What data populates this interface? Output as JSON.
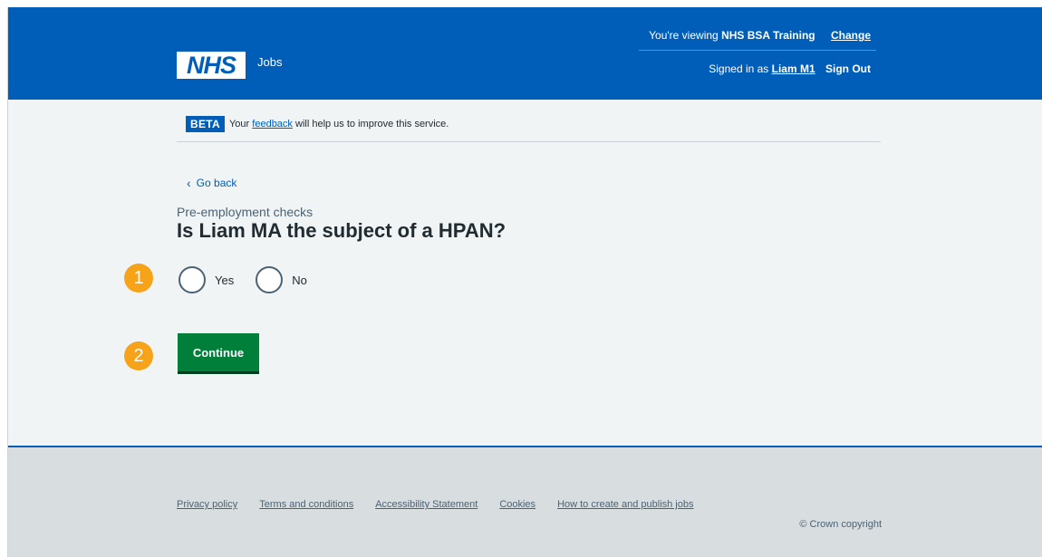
{
  "header": {
    "logo_text": "NHS",
    "service_name": "Jobs",
    "viewing_prefix": "You're viewing",
    "organisation": "NHS BSA Training",
    "change_label": "Change",
    "signed_in_prefix": "Signed in as",
    "user_name": "Liam M1",
    "sign_out_label": "Sign Out"
  },
  "beta_banner": {
    "tag": "BETA",
    "text_before": "Your",
    "link": "feedback",
    "text_after": "will help us to improve this service."
  },
  "main": {
    "back_link": "Go back",
    "caption": "Pre-employment checks",
    "heading": "Is Liam MA the subject of a HPAN?",
    "options": [
      {
        "label": "Yes",
        "selected": false
      },
      {
        "label": "No",
        "selected": false
      }
    ],
    "continue_label": "Continue"
  },
  "markers": [
    "1",
    "2"
  ],
  "footer": {
    "links": [
      "Privacy policy",
      "Terms and conditions",
      "Accessibility Statement",
      "Cookies",
      "How to create and publish jobs"
    ],
    "copyright": "© Crown copyright"
  },
  "colors": {
    "nhs_blue": "#005eb8",
    "button_green": "#007f3b",
    "marker_orange": "#f6a31a",
    "page_bg": "#f0f4f5",
    "footer_bg": "#d8dde0"
  },
  "icons": {
    "back": "chevron-left-icon"
  }
}
